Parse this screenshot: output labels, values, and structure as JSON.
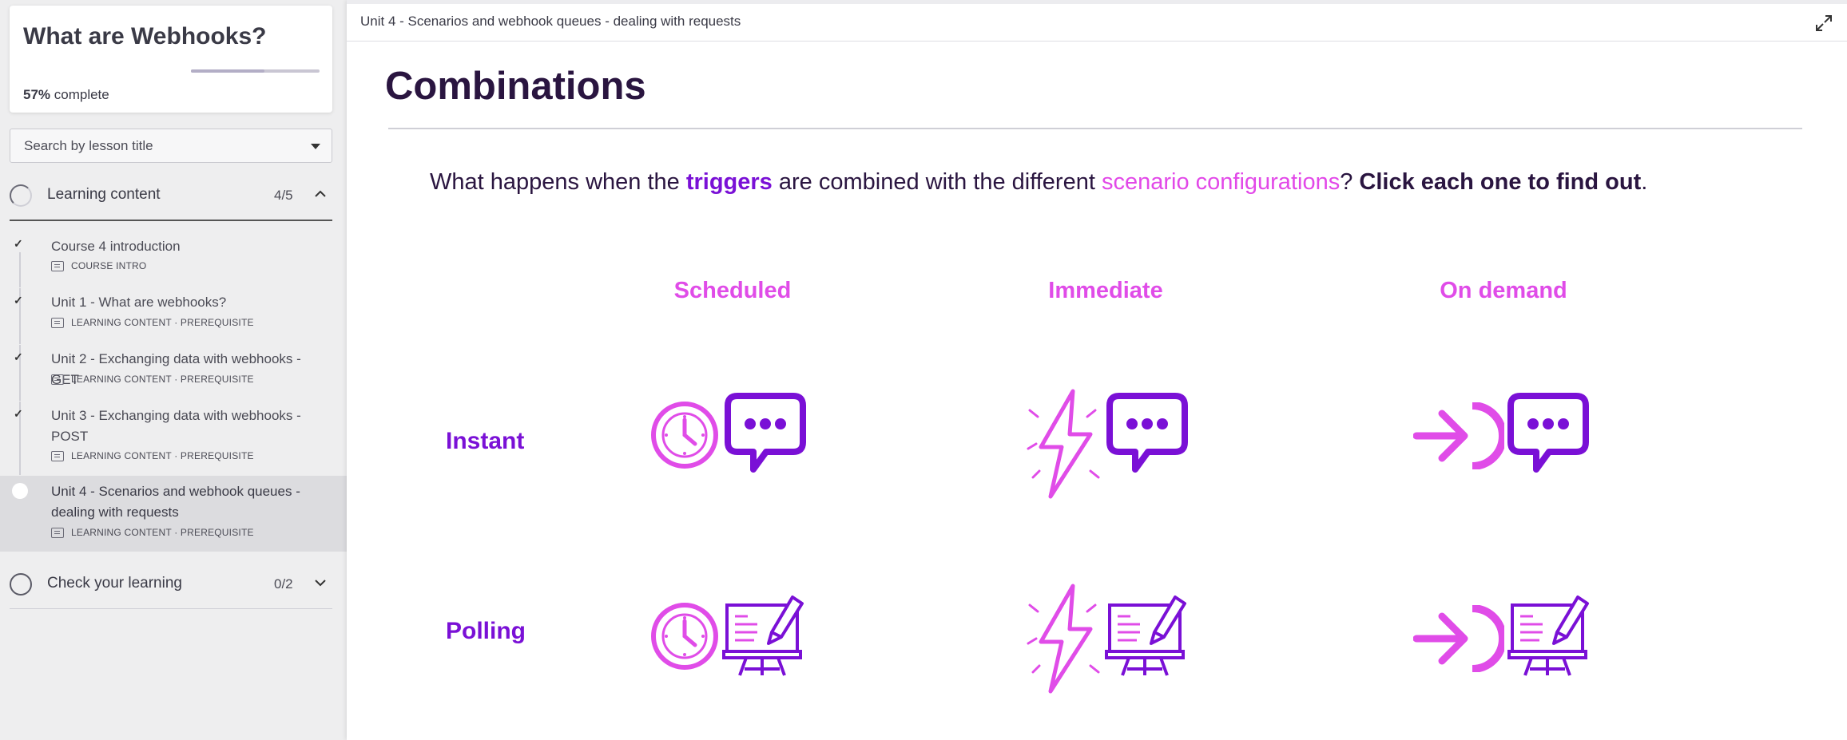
{
  "sidebar": {
    "course_title": "What are Webhooks?",
    "progress_percent": "57%",
    "progress_fraction": 0.57,
    "progress_suffix": " complete",
    "search_placeholder": "Search by lesson title",
    "sections": [
      {
        "label": "Learning content",
        "count": "4/5",
        "lessons": [
          {
            "title": "Course 4 introduction",
            "meta": "COURSE INTRO",
            "completed": true
          },
          {
            "title": "Unit 1 - What are webhooks?",
            "meta": "LEARNING CONTENT · PREREQUISITE",
            "completed": true
          },
          {
            "title": "Unit 2 - Exchanging data with webhooks - GET",
            "meta": "LEARNING CONTENT · PREREQUISITE",
            "completed": true
          },
          {
            "title": "Unit 3 - Exchanging data with webhooks - POST",
            "meta": "LEARNING CONTENT · PREREQUISITE",
            "completed": true
          },
          {
            "title": "Unit 4 - Scenarios and webhook queues - dealing with requests",
            "meta": "LEARNING CONTENT · PREREQUISITE",
            "completed": false,
            "active": true
          }
        ]
      },
      {
        "label": "Check your learning",
        "count": "0/2"
      }
    ]
  },
  "main": {
    "breadcrumb": "Unit 4 - Scenarios and webhook queues - dealing with requests",
    "page_title": "Combinations",
    "prompt": {
      "p1": "What happens when the ",
      "triggers": "triggers",
      "p2": " are combined with the different ",
      "configs": "scenario configurations",
      "p3": "? ",
      "cta": "Click each one to find out",
      "p4": "."
    },
    "columns": [
      "Scheduled",
      "Immediate",
      "On demand"
    ],
    "rows": [
      "Instant",
      "Polling"
    ]
  },
  "colors": {
    "purple": "#7a10d6",
    "pink": "#e04ce8",
    "ink": "#2a1540"
  },
  "icons": {
    "scheduled": "clock-icon",
    "immediate": "lightning-bolt-icon",
    "on_demand": "arrow-into-bracket-icon",
    "instant": "chat-bubble-icon",
    "polling": "computer-screen-icon"
  }
}
